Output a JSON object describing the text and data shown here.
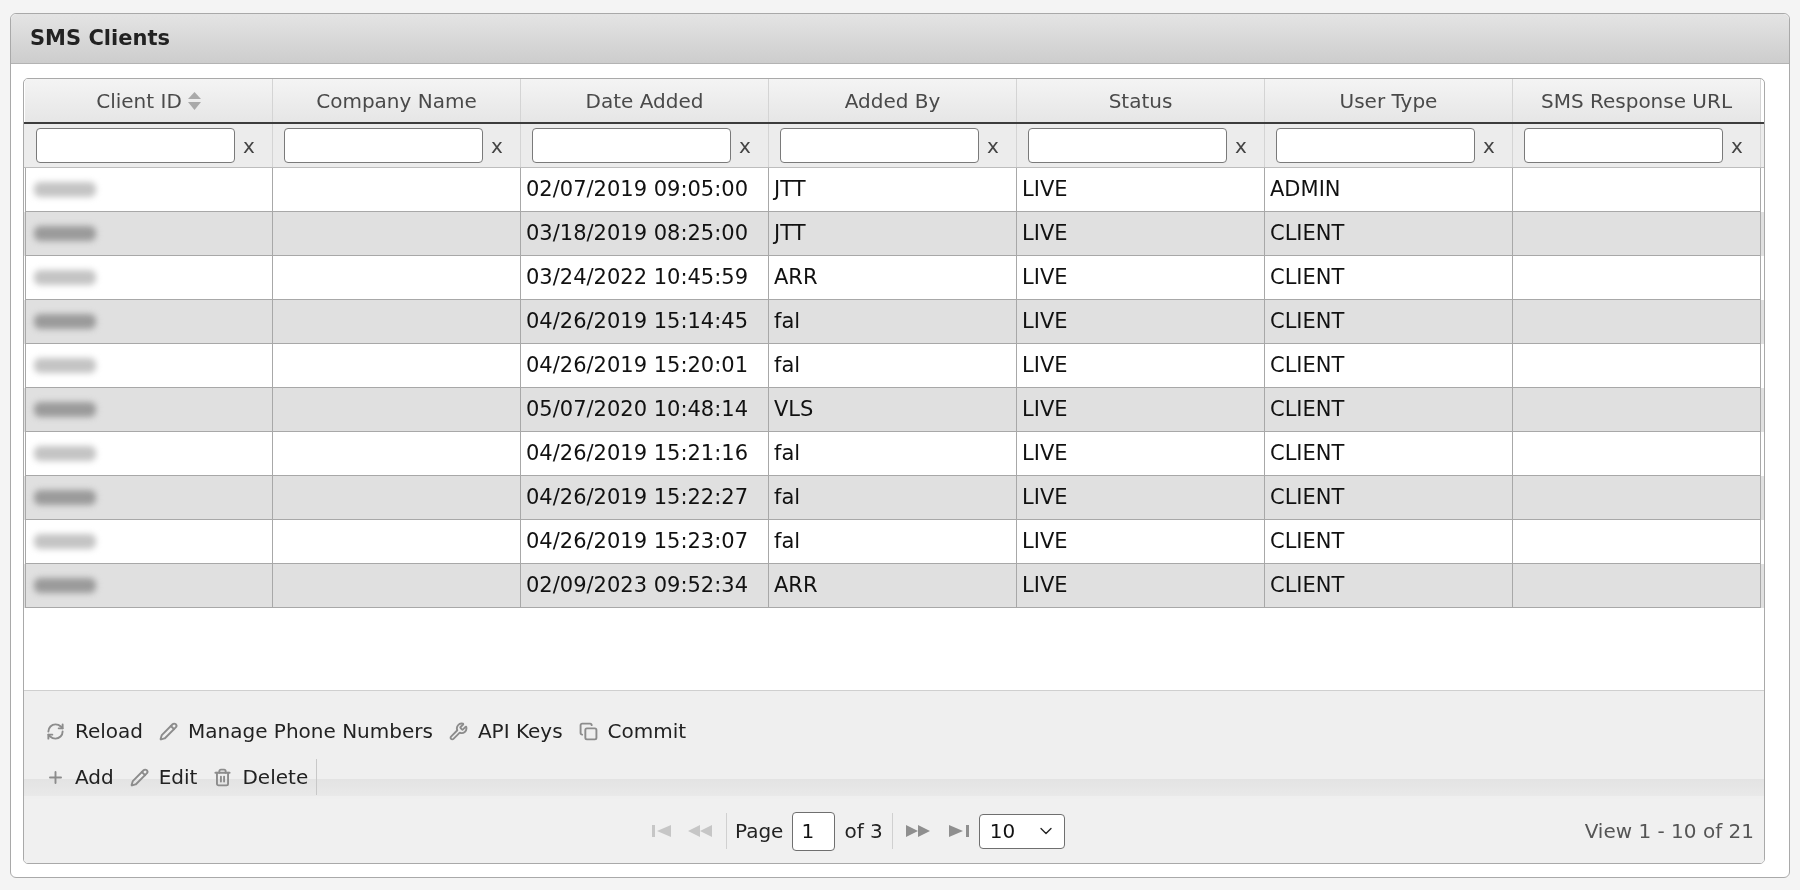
{
  "panel": {
    "title": "SMS Clients"
  },
  "columns": [
    {
      "label": "Client ID",
      "sortable": true,
      "clear": "x"
    },
    {
      "label": "Company Name",
      "sortable": false,
      "clear": "x"
    },
    {
      "label": "Date Added",
      "sortable": false,
      "clear": "x"
    },
    {
      "label": "Added By",
      "sortable": false,
      "clear": "x"
    },
    {
      "label": "Status",
      "sortable": false,
      "clear": "x"
    },
    {
      "label": "User Type",
      "sortable": false,
      "clear": "x"
    },
    {
      "label": "SMS Response URL",
      "sortable": false,
      "clear": "x"
    }
  ],
  "rows": [
    {
      "id_redacted": true,
      "date_added": "02/07/2019 09:05:00",
      "added_by": "JTT",
      "status": "LIVE",
      "user_type": "ADMIN"
    },
    {
      "id_redacted": true,
      "date_added": "03/18/2019 08:25:00",
      "added_by": "JTT",
      "status": "LIVE",
      "user_type": "CLIENT"
    },
    {
      "id_redacted": true,
      "date_added": "03/24/2022 10:45:59",
      "added_by": "ARR",
      "status": "LIVE",
      "user_type": "CLIENT"
    },
    {
      "id_redacted": true,
      "date_added": "04/26/2019 15:14:45",
      "added_by": "fal",
      "status": "LIVE",
      "user_type": "CLIENT"
    },
    {
      "id_redacted": true,
      "date_added": "04/26/2019 15:20:01",
      "added_by": "fal",
      "status": "LIVE",
      "user_type": "CLIENT"
    },
    {
      "id_redacted": true,
      "date_added": "05/07/2020 10:48:14",
      "added_by": "VLS",
      "status": "LIVE",
      "user_type": "CLIENT"
    },
    {
      "id_redacted": true,
      "date_added": "04/26/2019 15:21:16",
      "added_by": "fal",
      "status": "LIVE",
      "user_type": "CLIENT"
    },
    {
      "id_redacted": true,
      "date_added": "04/26/2019 15:22:27",
      "added_by": "fal",
      "status": "LIVE",
      "user_type": "CLIENT"
    },
    {
      "id_redacted": true,
      "date_added": "04/26/2019 15:23:07",
      "added_by": "fal",
      "status": "LIVE",
      "user_type": "CLIENT"
    },
    {
      "id_redacted": true,
      "date_added": "02/09/2023 09:52:34",
      "added_by": "ARR",
      "status": "LIVE",
      "user_type": "CLIENT"
    }
  ],
  "toolbar": [
    [
      {
        "kind": "reload",
        "label": "Reload"
      },
      {
        "kind": "manage",
        "label": "Manage Phone Numbers"
      },
      {
        "kind": "keys",
        "label": "API Keys"
      },
      {
        "kind": "commit",
        "label": "Commit"
      }
    ],
    [
      {
        "kind": "add",
        "label": "Add"
      },
      {
        "kind": "edit",
        "label": "Edit"
      },
      {
        "kind": "delete",
        "label": "Delete"
      }
    ]
  ],
  "pager": {
    "back": [
      {
        "kind": "first",
        "disabled": true
      },
      {
        "kind": "prev",
        "disabled": true
      }
    ],
    "page_label": "Page",
    "page": "1",
    "of_label": "of 3",
    "forward": [
      {
        "kind": "next",
        "disabled": false
      },
      {
        "kind": "last",
        "disabled": false
      }
    ],
    "page_size": "10",
    "summary": "View 1 - 10 of 21"
  }
}
